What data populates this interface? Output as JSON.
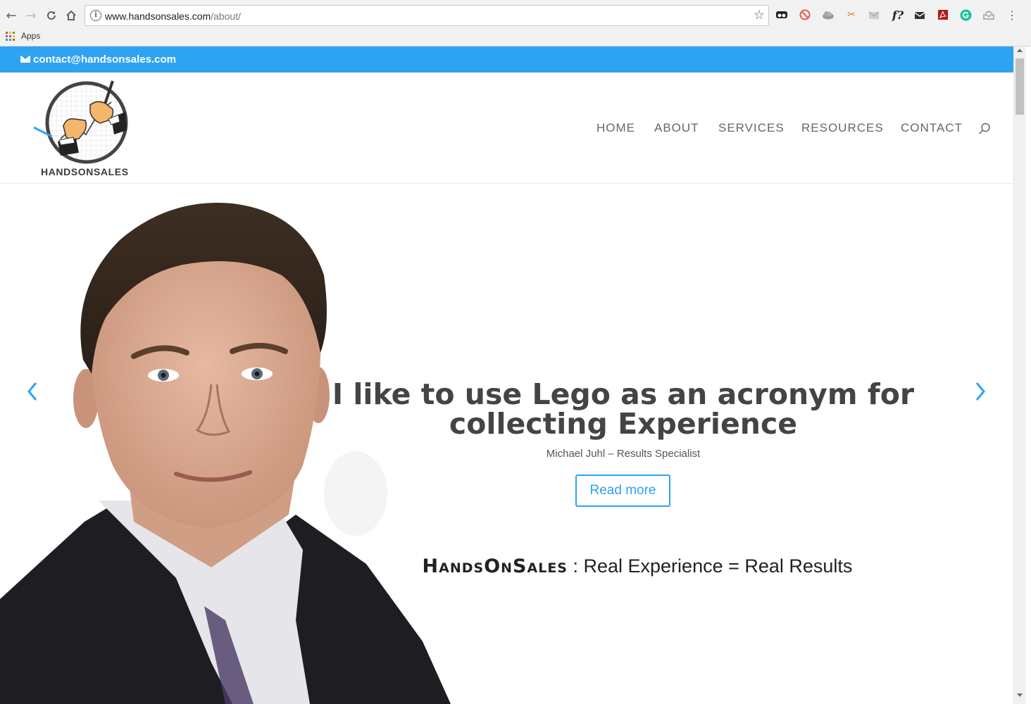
{
  "browser": {
    "url_host": "www.handsonsales.com",
    "url_path": "/about/",
    "bookmarks": [
      {
        "label": "Apps"
      }
    ],
    "extension_f_label": "f?"
  },
  "site": {
    "contact_email": "contact@handsonsales.com",
    "logo_text": "HANDSONSALES",
    "nav": [
      {
        "label": "HOME"
      },
      {
        "label": "ABOUT"
      },
      {
        "label": "SERVICES"
      },
      {
        "label": "RESOURCES"
      },
      {
        "label": "CONTACT"
      }
    ]
  },
  "hero": {
    "quote_line1": "I like to use Lego as an acronym for",
    "quote_line2": "collecting Experience",
    "byline": "Michael Juhl – Results Specialist",
    "button": "Read more",
    "tagline_brand": "HandsOnSales",
    "tagline_rest": " : Real Experience = Real Results"
  },
  "colors": {
    "accent": "#2ea3f2",
    "text_dark": "#444444",
    "menu_text": "#666666"
  }
}
